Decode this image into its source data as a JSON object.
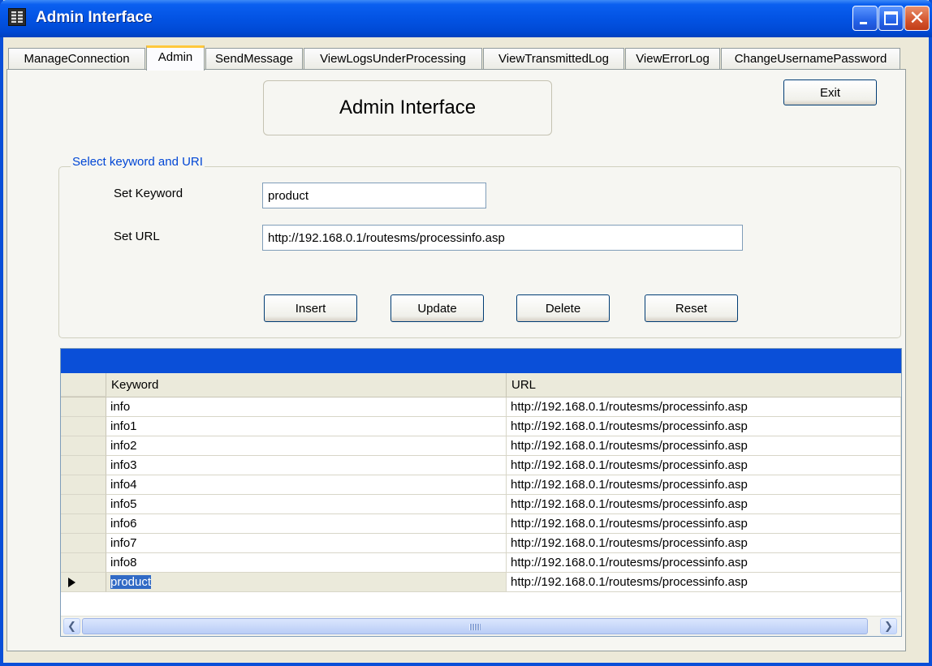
{
  "window": {
    "title": "Admin Interface"
  },
  "tabs": [
    {
      "label": "ManageConnection"
    },
    {
      "label": "Admin"
    },
    {
      "label": "SendMessage"
    },
    {
      "label": "ViewLogsUnderProcessing"
    },
    {
      "label": "ViewTransmittedLog"
    },
    {
      "label": "ViewErrorLog"
    },
    {
      "label": "ChangeUsernamePassword"
    }
  ],
  "active_tab": "Admin",
  "panel": {
    "heading": "Admin Interface",
    "exit_label": "Exit",
    "group_title": "Select keyword and URI",
    "keyword_label": "Set Keyword",
    "keyword_value": "product",
    "url_label": "Set URL",
    "url_value": "http://192.168.0.1/routesms/processinfo.asp",
    "buttons": {
      "insert": "Insert",
      "update": "Update",
      "delete": "Delete",
      "reset": "Reset"
    }
  },
  "grid": {
    "columns": [
      "Keyword",
      "URL"
    ],
    "rows": [
      [
        "info",
        "http://192.168.0.1/routesms/processinfo.asp"
      ],
      [
        "info1",
        "http://192.168.0.1/routesms/processinfo.asp"
      ],
      [
        "info2",
        "http://192.168.0.1/routesms/processinfo.asp"
      ],
      [
        "info3",
        "http://192.168.0.1/routesms/processinfo.asp"
      ],
      [
        "info4",
        "http://192.168.0.1/routesms/processinfo.asp"
      ],
      [
        "info5",
        "http://192.168.0.1/routesms/processinfo.asp"
      ],
      [
        "info6",
        "http://192.168.0.1/routesms/processinfo.asp"
      ],
      [
        "info7",
        "http://192.168.0.1/routesms/processinfo.asp"
      ],
      [
        "info8",
        "http://192.168.0.1/routesms/processinfo.asp"
      ],
      [
        "product",
        "http://192.168.0.1/routesms/processinfo.asp"
      ]
    ],
    "current_row": 9
  },
  "icons": {
    "app": "app-icon",
    "minimize": "minimize-icon",
    "maximize": "maximize-icon",
    "close": "close-icon",
    "row_pointer": "row-pointer-icon",
    "scroll_left": "scroll-left-icon",
    "scroll_right": "scroll-right-icon"
  },
  "colors": {
    "titlebar": "#0353e3",
    "group_title": "#0046d5",
    "grid_caption": "#0a4fd8",
    "selection": "#316ac5"
  }
}
